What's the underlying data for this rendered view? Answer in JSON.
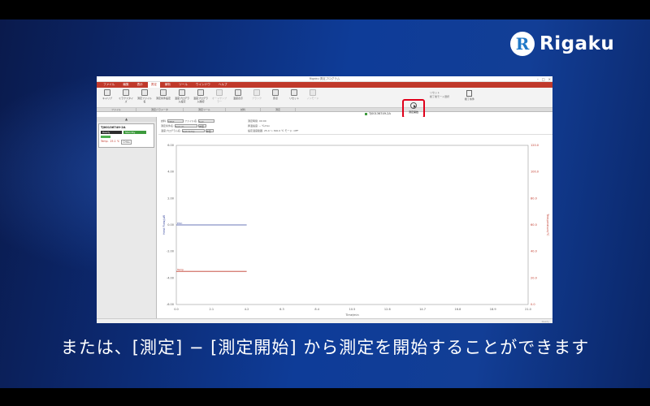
{
  "brand": {
    "name": "Rigaku",
    "mark": "R"
  },
  "subtitle": "または、[測定] − [測定開始] から測定を開始することができます",
  "window": {
    "title": "Rigaku 測定プログラム",
    "menu": [
      {
        "label": "ファイル"
      },
      {
        "label": "編集"
      },
      {
        "label": "表示"
      },
      {
        "label": "測定",
        "active": true
      },
      {
        "label": "解析"
      },
      {
        "label": "ツール"
      },
      {
        "label": "ウインドウ"
      },
      {
        "label": "ヘルプ"
      }
    ],
    "ribbon": {
      "buttons": [
        {
          "label": "キャリブ",
          "dim": false
        },
        {
          "label": "ミラクスタイズ",
          "dim": false
        },
        {
          "label": "測定ファイル名",
          "dim": false
        },
        {
          "label": "測定条件設定",
          "dim": false
        },
        {
          "label": "温度プログラム設定",
          "dim": false
        },
        {
          "label": "温度プログラム確認",
          "dim": false
        },
        {
          "label": "オートサンプラー",
          "dim": true
        },
        {
          "label": "温度表示",
          "dim": false
        },
        {
          "label": "ブランク",
          "dim": true
        },
        {
          "label": "原点",
          "dim": false
        },
        {
          "label": "リセット",
          "dim": false
        },
        {
          "label": "ノンモード",
          "dim": true
        }
      ],
      "start_button": "測定開始",
      "right_items": [
        "リセット",
        "終了後モード選択"
      ],
      "end_button": "終了条件",
      "groups": [
        "ファイル",
        "測定パラメータ",
        "測定ツール",
        "試料",
        "測定"
      ]
    },
    "device": {
      "name": "TJ00136749-2A",
      "state1": "Ready",
      "state2": "Standby",
      "temp_label": "Temp.",
      "temp_value": "25.1 ℃",
      "unit_btn": "CHILL"
    },
    "device_tab": "TJ00136749-2A",
    "info": {
      "sample_label": "試料:",
      "sample_val": "TEST",
      "file_label": "ファイル名:",
      "file_val": "test",
      "cond_label": "測定条件名:",
      "cond_val": "test-ch",
      "prog_label": "温度プログラム名:",
      "prog_val": "test-temp",
      "ref_btn": "参照",
      "time_label": "測定時間:",
      "time_val": "00:00",
      "rate_label": "昇温速度:",
      "rate_val": "-- ℃/min",
      "set_label": "設定温度範囲:",
      "set_val": "25.0 〜 300.0 ℃",
      "mode_label": "モード:",
      "mode_val": "OFF"
    },
    "status": "Ready"
  },
  "chart_data": {
    "type": "line",
    "title": "",
    "xlabel": "Time/min",
    "ylabel": "Heat Flow/µW",
    "ylabel2": "Temperature/℃",
    "xlim": [
      0,
      21
    ],
    "ylim": [
      -6,
      6
    ],
    "ylim2": [
      0,
      120
    ],
    "x_ticks": [
      "0.0",
      "2.1",
      "4.2",
      "6.3",
      "8.4",
      "10.5",
      "12.6",
      "14.7",
      "16.8",
      "18.9",
      "21.0"
    ],
    "y_ticks": [
      "6.00",
      "4.00",
      "2.00",
      "0.00",
      "-2.00",
      "-4.00",
      "-6.00"
    ],
    "y2_ticks": [
      "120.0",
      "100.0",
      "80.0",
      "60.0",
      "40.0",
      "20.0",
      "0.0"
    ],
    "series": [
      {
        "name": "DSC",
        "axis": "left",
        "color": "#3a4aa0",
        "x": [
          0,
          4.2
        ],
        "y": [
          0.0,
          0.0
        ]
      },
      {
        "name": "Temp",
        "axis": "right",
        "color": "#c0392b",
        "x": [
          0,
          4.2
        ],
        "y": [
          25.0,
          25.0
        ]
      }
    ],
    "grid": false
  }
}
